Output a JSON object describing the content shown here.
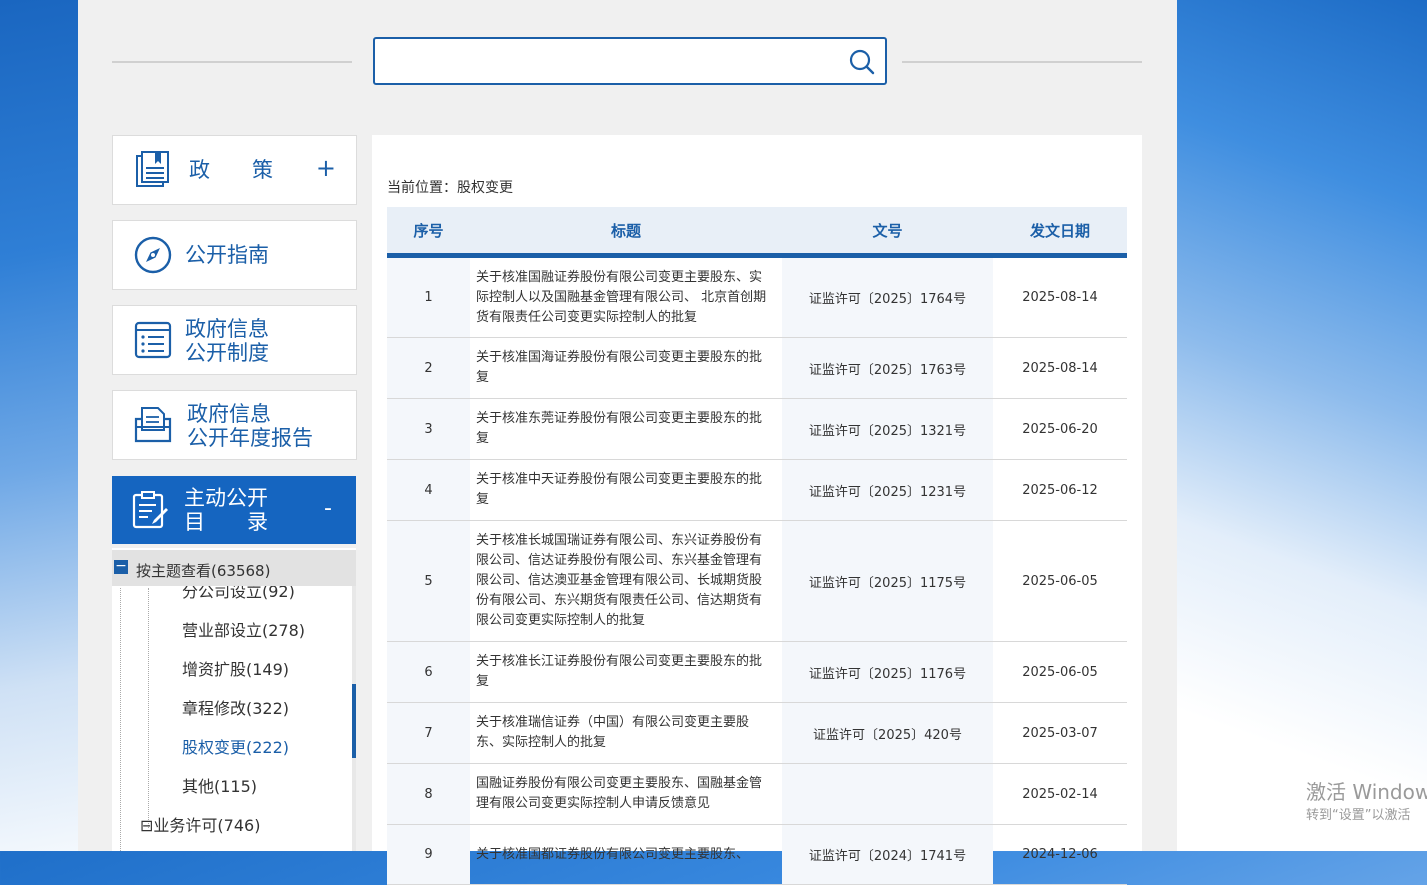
{
  "search": {
    "placeholder": "",
    "value": ""
  },
  "sidebar": {
    "cards": [
      {
        "label": "政　　策",
        "toggle": "+",
        "icon": "book-icon"
      },
      {
        "label": "公开指南",
        "icon": "compass-icon"
      },
      {
        "label_line1": "政府信息",
        "label_line2": "公开制度",
        "icon": "list-icon"
      },
      {
        "label_line1": "政府信息",
        "label_line2": "公开年度报告",
        "icon": "folder-document-icon"
      }
    ],
    "active_card": {
      "label_line1": "主动公开",
      "label_line2": "目　　录",
      "toggle": "-",
      "icon": "clipboard-edit-icon"
    },
    "tree": {
      "header": "按主题查看(63568)",
      "items": [
        {
          "label": "分公司设立(92)"
        },
        {
          "label": "营业部设立(278)"
        },
        {
          "label": "增资扩股(149)"
        },
        {
          "label": "章程修改(322)"
        },
        {
          "label": "股权变更(222)",
          "active": true
        },
        {
          "label": "其他(115)"
        },
        {
          "label": "⊟业务许可(746)"
        }
      ]
    }
  },
  "content": {
    "breadcrumb": "当前位置：股权变更",
    "columns": [
      "序号",
      "标题",
      "文号",
      "发文日期"
    ],
    "rows": [
      {
        "idx": "1",
        "title": "关于核准国融证券股份有限公司变更主要股东、实际控制人以及国融基金管理有限公司、 北京首创期货有限责任公司变更实际控制人的批复",
        "doc": "证监许可〔2025〕1764号",
        "date": "2025-08-14"
      },
      {
        "idx": "2",
        "title": "关于核准国海证券股份有限公司变更主要股东的批复",
        "doc": "证监许可〔2025〕1763号",
        "date": "2025-08-14"
      },
      {
        "idx": "3",
        "title": "关于核准东莞证券股份有限公司变更主要股东的批复",
        "doc": "证监许可〔2025〕1321号",
        "date": "2025-06-20"
      },
      {
        "idx": "4",
        "title": "关于核准中天证券股份有限公司变更主要股东的批复",
        "doc": "证监许可〔2025〕1231号",
        "date": "2025-06-12"
      },
      {
        "idx": "5",
        "title": "关于核准长城国瑞证券有限公司、东兴证券股份有限公司、信达证券股份有限公司、东兴基金管理有限公司、信达澳亚基金管理有限公司、长城期货股份有限公司、东兴期货有限责任公司、信达期货有限公司变更实际控制人的批复",
        "doc": "证监许可〔2025〕1175号",
        "date": "2025-06-05"
      },
      {
        "idx": "6",
        "title": "关于核准长江证券股份有限公司变更主要股东的批复",
        "doc": "证监许可〔2025〕1176号",
        "date": "2025-06-05"
      },
      {
        "idx": "7",
        "title": "关于核准瑞信证券（中国）有限公司变更主要股东、实际控制人的批复",
        "doc": "证监许可〔2025〕420号",
        "date": "2025-03-07"
      },
      {
        "idx": "8",
        "title": "国融证券股份有限公司变更主要股东、国融基金管理有限公司变更实际控制人申请反馈意见",
        "doc": "",
        "date": "2025-02-14"
      },
      {
        "idx": "9",
        "title": "关于核准国都证券股份有限公司变更主要股东、",
        "doc": "证监许可〔2024〕1741号",
        "date": "2024-12-06"
      }
    ]
  },
  "watermark": {
    "line1": "激活 Windows",
    "line2": "转到“设置”以激活"
  },
  "colors": {
    "accent": "#1b5fa8",
    "active_bg": "#1565c0"
  }
}
